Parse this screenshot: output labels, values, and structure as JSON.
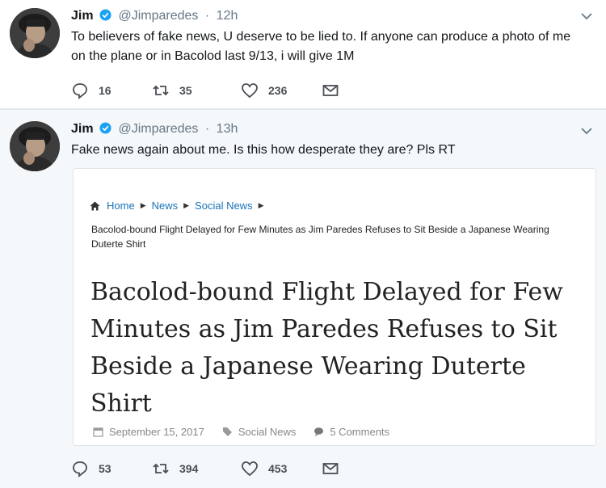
{
  "tweets": [
    {
      "name": "Jim",
      "handle": "@Jimparedes",
      "separator": "·",
      "time": "12h",
      "text": "To believers of fake news, U deserve to be lied to. If anyone can produce a photo of me on the plane or in Bacolod last 9/13, i will give 1M",
      "replies": "16",
      "retweets": "35",
      "likes": "236"
    },
    {
      "name": "Jim",
      "handle": "@Jimparedes",
      "separator": "·",
      "time": "13h",
      "text": "Fake news again about me. Is this how desperate they are? Pls RT",
      "replies": "53",
      "retweets": "394",
      "likes": "453",
      "card": {
        "breadcrumb": [
          "Home",
          "News",
          "Social News"
        ],
        "breadcrumb_separator": "▶",
        "crumb_title": "Bacolod-bound Flight Delayed for Few Minutes as Jim Paredes Refuses to Sit Beside a Japanese Wearing Duterte Shirt",
        "headline": "Bacolod-bound Flight Delayed for Few Minutes as Jim Paredes Refuses to Sit Beside a Japanese Wearing Duterte Shirt",
        "date": "September 15, 2017",
        "category": "Social News",
        "comments": "5 Comments"
      }
    }
  ],
  "icons": {
    "verified": "verified-badge-icon",
    "chevron": "chevron-down-icon",
    "reply": "reply-icon",
    "retweet": "retweet-icon",
    "like": "heart-icon",
    "dm": "envelope-icon"
  },
  "colors": {
    "verified_blue": "#1da1f2",
    "muted_text": "#657786",
    "link_blue": "#1a73b8",
    "selected_bg": "#f5f8fa"
  }
}
